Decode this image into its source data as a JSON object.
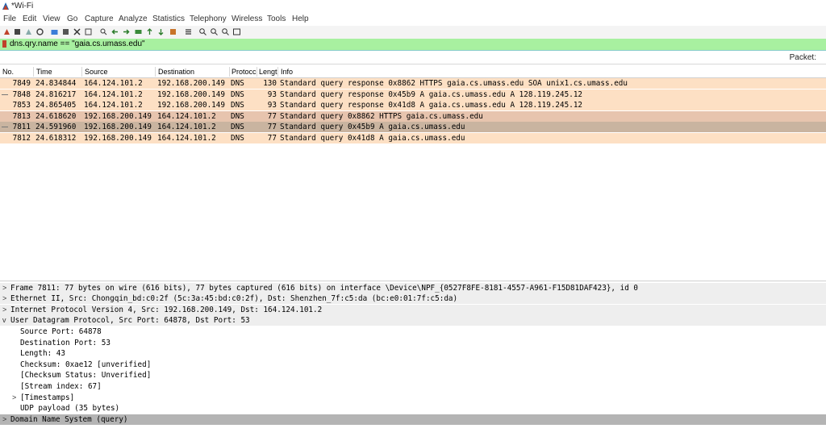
{
  "window": {
    "title": "*Wi-Fi"
  },
  "menu": [
    "File",
    "Edit",
    "View",
    "Go",
    "Capture",
    "Analyze",
    "Statistics",
    "Telephony",
    "Wireless",
    "Tools",
    "Help"
  ],
  "filter": {
    "value": "dns.qry.name == \"gaia.cs.umass.edu\""
  },
  "packet_label": "Packet:",
  "columns": [
    "No.",
    "Time",
    "Source",
    "Destination",
    "Protocc",
    "Lengt",
    "Info"
  ],
  "colors": {
    "row_dns": "#fde0c4",
    "row_selected": "#c9b4a0",
    "row_related": "#e7c4ae",
    "filter_bg": "#a8f0a0",
    "detail_selected": "#b4b4b4",
    "detail_section": "#eeeeee"
  },
  "packets": [
    {
      "no": "7849",
      "time": "24.834844",
      "src": "164.124.101.2",
      "dst": "192.168.200.149",
      "proto": "DNS",
      "len": "130",
      "info": "Standard query response 0x8862 HTTPS gaia.cs.umass.edu SOA unix1.cs.umass.edu"
    },
    {
      "no": "7848",
      "time": "24.816217",
      "src": "164.124.101.2",
      "dst": "192.168.200.149",
      "proto": "DNS",
      "len": "93",
      "info": "Standard query response 0x45b9 A gaia.cs.umass.edu A 128.119.245.12"
    },
    {
      "no": "7853",
      "time": "24.865405",
      "src": "164.124.101.2",
      "dst": "192.168.200.149",
      "proto": "DNS",
      "len": "93",
      "info": "Standard query response 0x41d8 A gaia.cs.umass.edu A 128.119.245.12"
    },
    {
      "no": "7813",
      "time": "24.618620",
      "src": "192.168.200.149",
      "dst": "164.124.101.2",
      "proto": "DNS",
      "len": "77",
      "info": "Standard query 0x8862 HTTPS gaia.cs.umass.edu"
    },
    {
      "no": "7811",
      "time": "24.591960",
      "src": "192.168.200.149",
      "dst": "164.124.101.2",
      "proto": "DNS",
      "len": "77",
      "info": "Standard query 0x45b9 A gaia.cs.umass.edu"
    },
    {
      "no": "7812",
      "time": "24.618312",
      "src": "192.168.200.149",
      "dst": "164.124.101.2",
      "proto": "DNS",
      "len": "77",
      "info": "Standard query 0x41d8 A gaia.cs.umass.edu"
    }
  ],
  "details": [
    {
      "text": "Frame 7811: 77 bytes on wire (616 bits), 77 bytes captured (616 bits) on interface \\Device\\NPF_{0527F8FE-8181-4557-A961-F15D81DAF423}, id 0",
      "arrow": ">"
    },
    {
      "text": "Ethernet II, Src: Chongqin_bd:c0:2f (5c:3a:45:bd:c0:2f), Dst: Shenzhen_7f:c5:da (bc:e0:01:7f:c5:da)",
      "arrow": ">"
    },
    {
      "text": "Internet Protocol Version 4, Src: 192.168.200.149, Dst: 164.124.101.2",
      "arrow": ">"
    },
    {
      "text": "User Datagram Protocol, Src Port: 64878, Dst Port: 53",
      "arrow": "v"
    },
    {
      "text": "Source Port: 64878",
      "arrow": ""
    },
    {
      "text": "Destination Port: 53",
      "arrow": ""
    },
    {
      "text": "Length: 43",
      "arrow": ""
    },
    {
      "text": "Checksum: 0xae12 [unverified]",
      "arrow": ""
    },
    {
      "text": "[Checksum Status: Unverified]",
      "arrow": ""
    },
    {
      "text": "[Stream index: 67]",
      "arrow": ""
    },
    {
      "text": "[Timestamps]",
      "arrow": ">"
    },
    {
      "text": "UDP payload (35 bytes)",
      "arrow": ""
    },
    {
      "text": "Domain Name System (query)",
      "arrow": ">"
    }
  ]
}
